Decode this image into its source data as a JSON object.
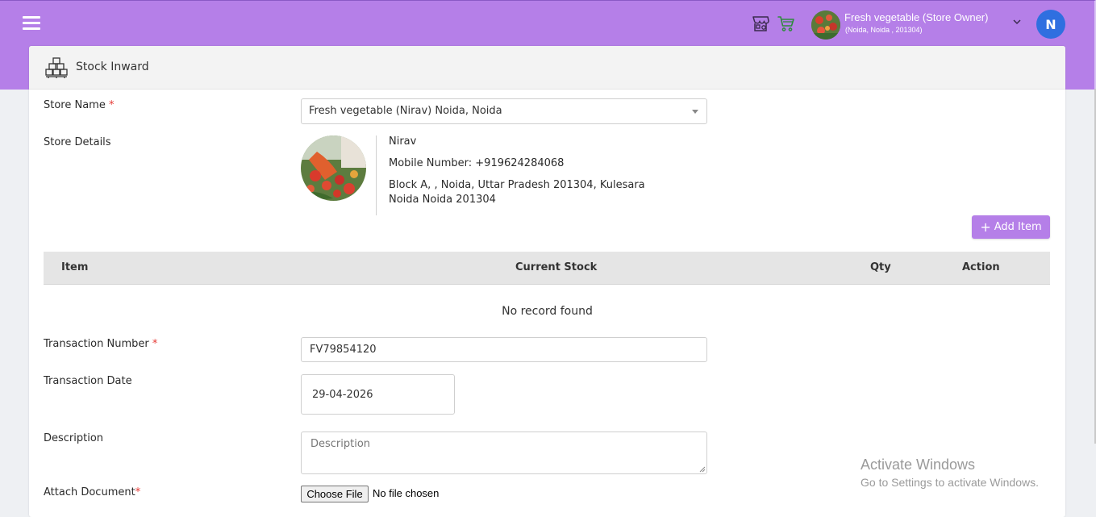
{
  "topbar": {
    "store_name": "Fresh vegetable (Store Owner)",
    "store_location": "(Noida, Noida , 201304)",
    "avatar_initial": "N",
    "brand_color": "#b57fe8"
  },
  "page": {
    "title": "Stock Inward"
  },
  "form": {
    "store_name_label": "Store Name",
    "store_name_value": "Fresh vegetable (Nirav) Noida, Noida",
    "store_details_label": "Store Details",
    "store_owner": "Nirav",
    "store_mobile": "Mobile Number: +919624284068",
    "store_address_1": "Block A, , Noida, Uttar Pradesh 201304, Kulesara",
    "store_address_2": "Noida Noida 201304",
    "add_item_label": "Add Item",
    "table_headers": {
      "item": "Item",
      "current_stock": "Current Stock",
      "qty": "Qty",
      "action": "Action"
    },
    "no_record": "No record found",
    "transaction_number_label": "Transaction Number",
    "transaction_number_value": "FV79854120",
    "transaction_date_label": "Transaction Date",
    "transaction_date_value": "29-04-2026",
    "description_label": "Description",
    "description_placeholder": "Description",
    "attach_document_label": "Attach Document",
    "choose_file_label": "Choose File",
    "no_file_text": "No file chosen",
    "required_mark": "*"
  },
  "watermark": {
    "line1": "Activate Windows",
    "line2": "Go to Settings to activate Windows."
  },
  "icons": {
    "menu": "hamburger-icon",
    "store": "store-icon",
    "cart": "cart-icon",
    "header": "boxes-icon"
  }
}
